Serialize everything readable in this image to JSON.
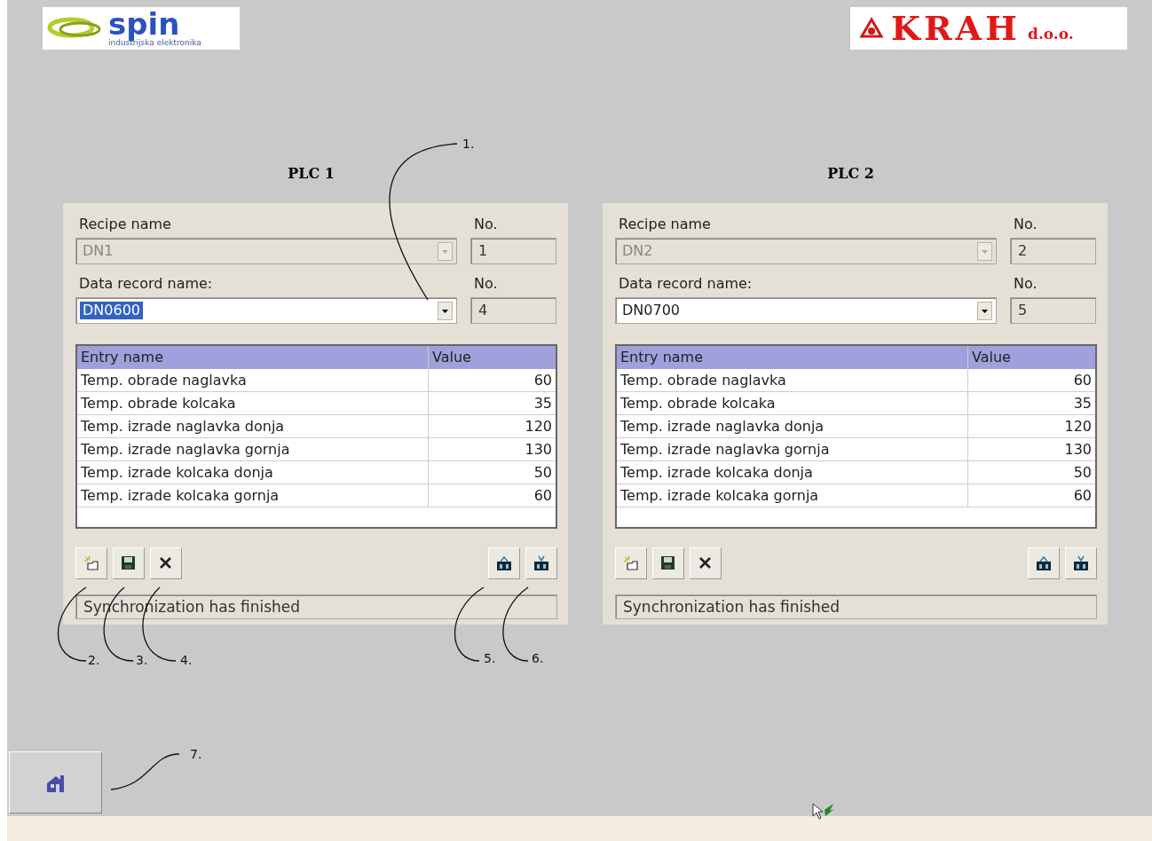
{
  "header": {
    "left_logo": {
      "name": "spin",
      "tagline": "industrijska elektronika"
    },
    "right_logo": {
      "name": "KRAH",
      "suffix": "d.o.o."
    }
  },
  "panels": [
    {
      "title": "PLC 1",
      "recipe": {
        "label": "Recipe name",
        "value": "DN1",
        "disabled": true,
        "no_label": "No.",
        "no": "1"
      },
      "record": {
        "label": "Data record name:",
        "value": "DN0600",
        "disabled": false,
        "highlighted": true,
        "no_label": "No.",
        "no": "4"
      },
      "table": {
        "columns": [
          "Entry name",
          "Value"
        ],
        "rows": [
          [
            "Temp. obrade naglavka",
            "60"
          ],
          [
            "Temp. obrade kolcaka",
            "35"
          ],
          [
            "Temp. izrade naglavka donja",
            "120"
          ],
          [
            "Temp. izrade naglavka gornja",
            "130"
          ],
          [
            "Temp. izrade kolcaka donja",
            "50"
          ],
          [
            "Temp. izrade kolcaka gornja",
            "60"
          ]
        ]
      },
      "left_buttons": [
        {
          "kind": "new"
        },
        {
          "kind": "save"
        },
        {
          "kind": "delete"
        }
      ],
      "right_buttons": [
        {
          "kind": "box_up"
        },
        {
          "kind": "box_down"
        }
      ],
      "status": "Synchronization has finished"
    },
    {
      "title": "PLC 2",
      "recipe": {
        "label": "Recipe name",
        "value": "DN2",
        "disabled": true,
        "no_label": "No.",
        "no": "2"
      },
      "record": {
        "label": "Data record name:",
        "value": "DN0700",
        "disabled": false,
        "highlighted": false,
        "no_label": "No.",
        "no": "5"
      },
      "table": {
        "columns": [
          "Entry name",
          "Value"
        ],
        "rows": [
          [
            "Temp. obrade naglavka",
            "60"
          ],
          [
            "Temp. obrade kolcaka",
            "35"
          ],
          [
            "Temp. izrade naglavka donja",
            "120"
          ],
          [
            "Temp. izrade naglavka gornja",
            "130"
          ],
          [
            "Temp. izrade kolcaka donja",
            "50"
          ],
          [
            "Temp. izrade kolcaka gornja",
            "60"
          ]
        ]
      },
      "left_buttons": [
        {
          "kind": "new"
        },
        {
          "kind": "save"
        },
        {
          "kind": "delete"
        }
      ],
      "right_buttons": [
        {
          "kind": "box_up"
        },
        {
          "kind": "box_down"
        }
      ],
      "status": "Synchronization has finished"
    }
  ],
  "callouts": [
    {
      "label": "1."
    },
    {
      "label": "2."
    },
    {
      "label": "3."
    },
    {
      "label": "4."
    },
    {
      "label": "5."
    },
    {
      "label": "6."
    },
    {
      "label": "7."
    }
  ]
}
